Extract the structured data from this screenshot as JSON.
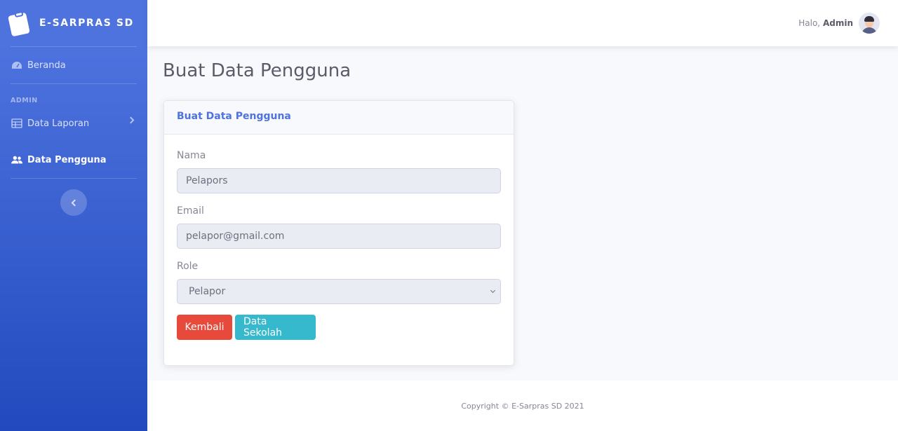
{
  "app": {
    "brand": "E-SARPRAS SD"
  },
  "sidebar": {
    "items": [
      {
        "label": "Beranda",
        "icon": "dashboard-icon"
      },
      {
        "label": "Data Laporan",
        "icon": "table-icon"
      },
      {
        "label": "Data Pengguna",
        "icon": "users-icon"
      }
    ],
    "heading": "ADMIN"
  },
  "topbar": {
    "greeting": "Halo,",
    "user": "Admin"
  },
  "page": {
    "title": "Buat Data Pengguna"
  },
  "form": {
    "card_title": "Buat Data Pengguna",
    "name_label": "Nama",
    "name_value": "Pelapors",
    "email_label": "Email",
    "email_value": "pelapor@gmail.com",
    "role_label": "Role",
    "role_value": "Pelapor",
    "back_label": "Kembali",
    "school_label": "Data Sekolah"
  },
  "footer": {
    "text": "Copyright © E-Sarpras SD 2021"
  },
  "colors": {
    "primary": "#4e73df",
    "danger": "#e74a3b",
    "info": "#36b9cc"
  }
}
